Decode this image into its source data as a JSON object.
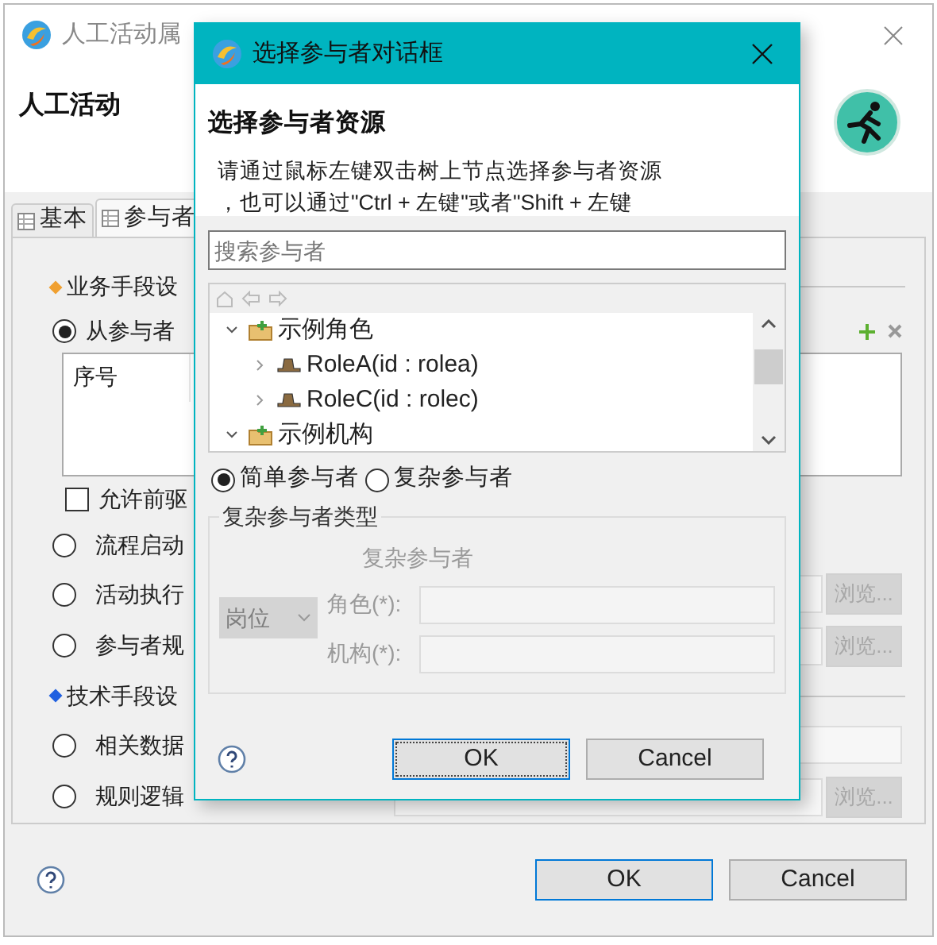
{
  "window": {
    "title": "人工活动属",
    "heading": "人工活动",
    "tabs": [
      {
        "label": "基本",
        "selected": false
      },
      {
        "label": "参与者",
        "selected": true
      }
    ],
    "options": [
      {
        "kind": "section",
        "label": "业务手段设",
        "color": "#f0a030"
      },
      {
        "kind": "list_choice",
        "label": "从参与者",
        "selected": true,
        "columns": [
          "序号"
        ]
      },
      {
        "kind": "checkbox",
        "label": "允许前驱",
        "checked": false
      },
      {
        "kind": "radio",
        "label": "流程启动",
        "selected": false
      },
      {
        "kind": "browse_choice",
        "label": "活动执行",
        "selected": false,
        "button": {
          "label": "浏览...",
          "disabled": true
        }
      },
      {
        "kind": "browse_choice",
        "label": "参与者规",
        "selected": false,
        "button": {
          "label": "浏览...",
          "disabled": true
        }
      },
      {
        "kind": "section",
        "label": "技术手段设",
        "color": "#2060e0"
      },
      {
        "kind": "field_choice",
        "label": "相关数据",
        "selected": false
      },
      {
        "kind": "browse_choice",
        "label": "规则逻辑",
        "selected": false,
        "button": {
          "label": "浏览...",
          "disabled": true
        }
      }
    ],
    "buttons": [
      {
        "label": "OK",
        "default": true
      },
      {
        "label": "Cancel",
        "default": false
      }
    ]
  },
  "dialog": {
    "title": "选择参与者对话框",
    "heading": "选择参与者资源",
    "description_lines": [
      "请通过鼠标左键双击树上节点选择参与者资源",
      "，也可以通过\"Ctrl + 左键\"或者\"Shift + 左键"
    ],
    "search": {
      "placeholder": "搜索参与者"
    },
    "tree": [
      {
        "label": "示例角色",
        "kind": "folder",
        "expanded": true,
        "children": [
          {
            "label": "RoleA(id : rolea)",
            "kind": "role",
            "expanded": false
          },
          {
            "label": "RoleC(id : rolec)",
            "kind": "role",
            "expanded": false
          }
        ]
      },
      {
        "label": "示例机构",
        "kind": "folder",
        "expanded": true
      }
    ],
    "participant_types": [
      {
        "label": "简单参与者",
        "selected": true
      },
      {
        "label": "复杂参与者",
        "selected": false
      }
    ],
    "complex_group": {
      "title": "复杂参与者类型",
      "disabled": true,
      "subtitle": "复杂参与者",
      "type_select": "岗位",
      "fields": [
        {
          "label": "角色(*):"
        },
        {
          "label": "机构(*):"
        }
      ]
    },
    "buttons": [
      {
        "label": "OK",
        "default": true
      },
      {
        "label": "Cancel",
        "default": false
      }
    ]
  }
}
